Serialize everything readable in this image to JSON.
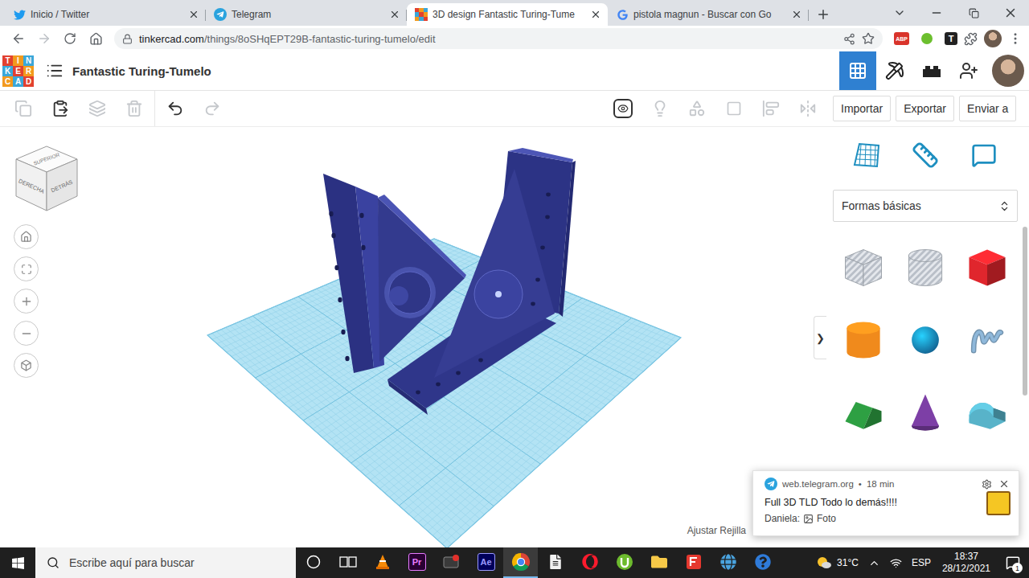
{
  "browser": {
    "tabs": [
      {
        "label": "Inicio / Twitter",
        "selected": false,
        "kind": "twitter"
      },
      {
        "label": "Telegram",
        "selected": false,
        "kind": "telegram"
      },
      {
        "label": "3D design Fantastic Turing-Tume",
        "selected": true,
        "kind": "tinkercad"
      },
      {
        "label": "pistola magnun - Buscar con Go",
        "selected": false,
        "kind": "google"
      }
    ],
    "nav": [
      {
        "name": "back",
        "disabled": false
      },
      {
        "name": "forward",
        "disabled": true
      },
      {
        "name": "reload",
        "disabled": false
      },
      {
        "name": "home",
        "disabled": false
      }
    ],
    "url_host": "tinkercad.com",
    "url_path": "/things/8oSHqEPT29B-fantastic-turing-tumelo/edit",
    "extensions": [
      {
        "label": "ABP",
        "color": "#d9342b"
      },
      {
        "label": "T",
        "color": "#222222"
      }
    ]
  },
  "app": {
    "logo": [
      "T",
      "I",
      "N",
      "K",
      "E",
      "R",
      "C",
      "A",
      "D"
    ],
    "title": "Fantastic Turing-Tumelo",
    "modes": [
      {
        "name": "3d-design",
        "selected": true
      },
      {
        "name": "blocks",
        "selected": false
      },
      {
        "name": "bricks",
        "selected": false
      }
    ]
  },
  "toolbar": {
    "edit_tools": [
      {
        "name": "copy",
        "disabled": true
      },
      {
        "name": "paste",
        "disabled": false
      },
      {
        "name": "duplicate",
        "disabled": true
      },
      {
        "name": "delete",
        "disabled": true
      },
      {
        "name": "undo",
        "disabled": false
      },
      {
        "name": "redo",
        "disabled": true
      }
    ],
    "view_tools": [
      {
        "name": "notes",
        "disabled": false
      },
      {
        "name": "lights",
        "disabled": true
      },
      {
        "name": "group",
        "disabled": true
      },
      {
        "name": "ungroup",
        "disabled": true
      },
      {
        "name": "align",
        "disabled": true
      },
      {
        "name": "mirror",
        "disabled": true
      }
    ],
    "buttons": [
      "Importar",
      "Exportar",
      "Enviar a"
    ]
  },
  "view_cube": {
    "top": "SUPERIOR",
    "left": "DERECHA",
    "right": "DETRÁS"
  },
  "canvas": {
    "snap_label": "Ajustar Rejilla",
    "collapse": "❯"
  },
  "panel": {
    "category": "Formas básicas",
    "shapes": [
      {
        "kind": "box",
        "hole": true,
        "color": "#b9bfc8"
      },
      {
        "kind": "cylinder",
        "hole": true,
        "color": "#b9bfc8"
      },
      {
        "kind": "box",
        "hole": false,
        "color": "#e0262d"
      },
      {
        "kind": "cylinder",
        "hole": false,
        "color": "#f08a1c"
      },
      {
        "kind": "sphere",
        "hole": false,
        "color": "#1a8ccf"
      },
      {
        "kind": "scribble",
        "hole": false,
        "color": "#8fb8da"
      },
      {
        "kind": "roof",
        "hole": false,
        "color": "#2ea043"
      },
      {
        "kind": "cone",
        "hole": false,
        "color": "#7d3fa6"
      },
      {
        "kind": "round-roof",
        "hole": false,
        "color": "#58b3c9"
      }
    ]
  },
  "notification": {
    "source": "web.telegram.org",
    "separator": "•",
    "time": "18 min",
    "message": "Full 3D TLD Todo lo demás!!!!",
    "sender": "Daniela:",
    "attachment": "Foto"
  },
  "taskbar": {
    "search": "Escribe aquí para buscar",
    "apps": [
      {
        "kind": "cortana",
        "label": "",
        "active": false
      },
      {
        "kind": "taskview",
        "label": "",
        "active": false
      },
      {
        "kind": "vlc",
        "label": "",
        "active": false
      },
      {
        "kind": "premiere",
        "label": "Pr",
        "active": false
      },
      {
        "kind": "record",
        "label": "",
        "active": false
      },
      {
        "kind": "aftereffects",
        "label": "Ae",
        "active": false
      },
      {
        "kind": "chrome",
        "label": "",
        "active": true
      },
      {
        "kind": "file",
        "label": "",
        "active": false
      },
      {
        "kind": "opera",
        "label": "",
        "active": false
      },
      {
        "kind": "utorrent",
        "label": "",
        "active": false
      },
      {
        "kind": "explorer",
        "label": "",
        "active": false
      },
      {
        "kind": "foxit",
        "label": "",
        "active": false
      },
      {
        "kind": "globe",
        "label": "",
        "active": false
      },
      {
        "kind": "help",
        "label": "",
        "active": false
      }
    ],
    "weather": "31°C",
    "language": "ESP",
    "time": "18:37",
    "date": "28/12/2021",
    "notifications": "1"
  }
}
